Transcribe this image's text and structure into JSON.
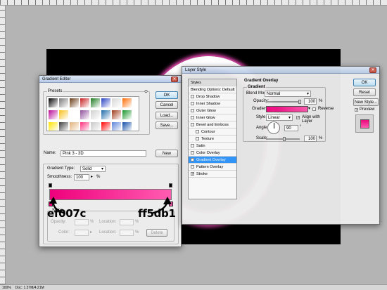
{
  "status": {
    "zoom": "100%",
    "doc": "Doc: 1.37M/4.21M"
  },
  "gradient_editor": {
    "title": "Gradient Editor",
    "presets_label": "Presets",
    "buttons": {
      "ok": "OK",
      "cancel": "Cancel",
      "load": "Load...",
      "save": "Save...",
      "new": "New",
      "delete": "Delete"
    },
    "name_label": "Name:",
    "name_value": "Pink 3 - 3D",
    "gradient_type_group": "Gradient Type:",
    "gradient_type_value": "Solid",
    "smoothness_label": "Smoothness:",
    "smoothness_value": "100",
    "percent": "%",
    "stops_label": "Stops",
    "opacity_label": "Opacity:",
    "color_label": "Color:",
    "location_label": "Location:",
    "delete_label": "Delete",
    "color_start": "#ef007c",
    "color_end": "#ff5db1",
    "annotation_left": "ef007c",
    "annotation_right": "ff5db1",
    "preset_colors": [
      "#000000",
      "#7a7a7a",
      "#6a3b14",
      "#c81f1f",
      "#1b7a1f",
      "#2a42c2",
      "#d8d8d8",
      "#ff6a00",
      "#b70b96",
      "#f7c01a",
      "#ffffff",
      "#8f4f9c",
      "#d0d0d0",
      "#1e69a9",
      "#a03a1a",
      "#16962a",
      "#ffe400",
      "#3c3c3c",
      "#e1b07a",
      "#ff2d7d",
      "#c8c8c8",
      "#ff0000",
      "#5c82d8",
      "#0f4ca8"
    ]
  },
  "layer_style": {
    "title": "Layer Style",
    "styles_header": "Styles",
    "items": [
      {
        "label": "Blending Options: Default",
        "checked": false,
        "check": false
      },
      {
        "label": "Drop Shadow",
        "checked": false,
        "check": true
      },
      {
        "label": "Inner Shadow",
        "checked": false,
        "check": true
      },
      {
        "label": "Outer Glow",
        "checked": false,
        "check": true
      },
      {
        "label": "Inner Glow",
        "checked": false,
        "check": true
      },
      {
        "label": "Bevel and Emboss",
        "checked": false,
        "check": true
      },
      {
        "label": "Contour",
        "checked": false,
        "check": true
      },
      {
        "label": "Texture",
        "checked": false,
        "check": true
      },
      {
        "label": "Satin",
        "checked": false,
        "check": true
      },
      {
        "label": "Color Overlay",
        "checked": false,
        "check": true
      },
      {
        "label": "Gradient Overlay",
        "checked": true,
        "check": true
      },
      {
        "label": "Pattern Overlay",
        "checked": false,
        "check": true
      },
      {
        "label": "Stroke",
        "checked": true,
        "check": true
      }
    ],
    "section_title": "Gradient Overlay",
    "section_sub": "Gradient",
    "blend_mode_label": "Blend Mode:",
    "blend_mode_value": "Normal",
    "opacity_label": "Opacity:",
    "opacity_value": "100",
    "gradient_label": "Gradient:",
    "reverse_label": "Reverse",
    "style_label": "Style:",
    "style_value": "Linear",
    "align_label": "Align with Layer",
    "angle_label": "Angle:",
    "angle_value": "90",
    "degree": "°",
    "scale_label": "Scale:",
    "scale_value": "100",
    "percent": "%",
    "buttons": {
      "ok": "OK",
      "cancel": "Reset",
      "new_style": "New Style...",
      "preview": "Preview"
    }
  }
}
